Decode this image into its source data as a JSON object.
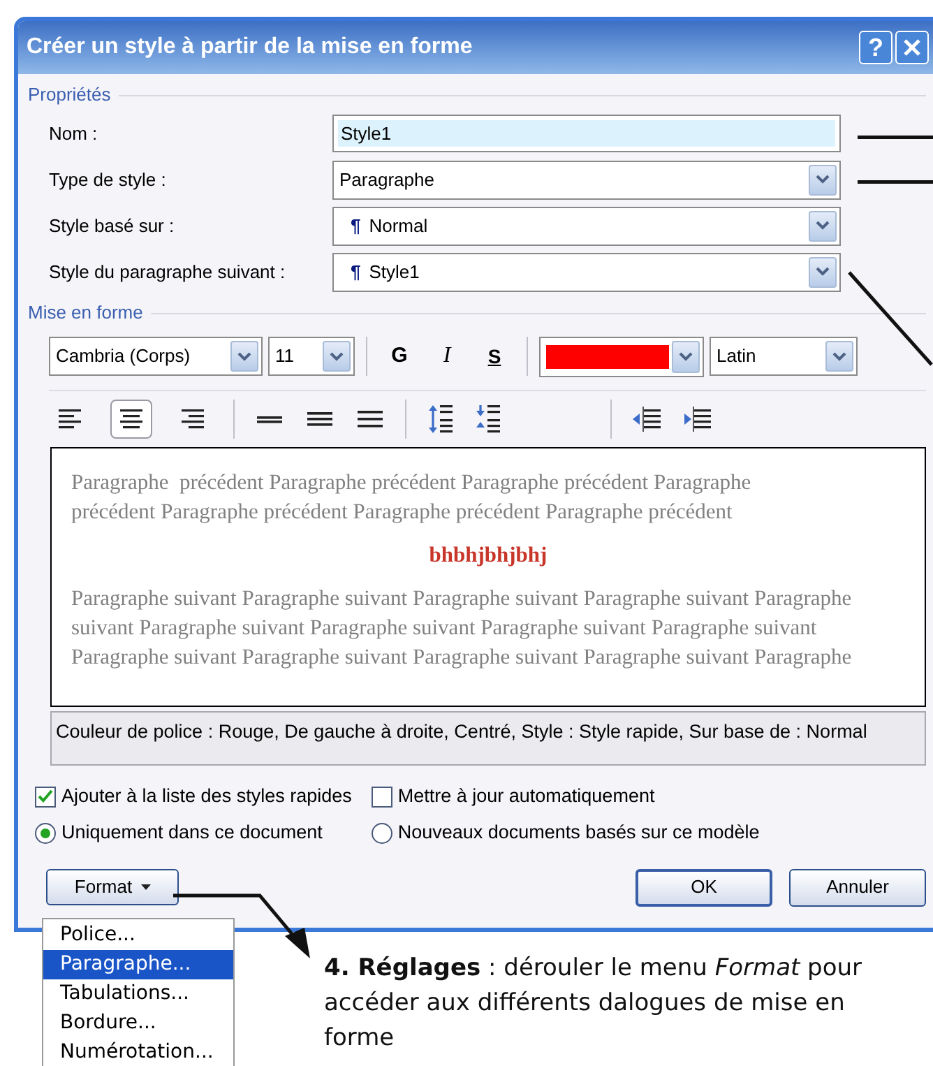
{
  "window": {
    "title": "Créer un style à partir de la mise en forme",
    "help": "?"
  },
  "properties": {
    "heading": "Propriétés",
    "fields": [
      {
        "kind": "text",
        "label": "Nom :",
        "value": "Style1"
      },
      {
        "kind": "dropdown",
        "label": "Type de style :",
        "value": "Paragraphe"
      },
      {
        "kind": "dropdown",
        "label": "Style basé sur :",
        "symbol": "¶",
        "value": "Normal"
      },
      {
        "kind": "dropdown",
        "label": "Style du paragraphe suivant :",
        "symbol": "¶",
        "value": "Style1"
      }
    ]
  },
  "formatting": {
    "heading": "Mise en forme",
    "font": "Cambria (Corps)",
    "size": "11",
    "bold": "G",
    "italic": "I",
    "underline": "S",
    "color_swatch": {
      "color": "#ff0000"
    },
    "script": "Latin",
    "alignment": [
      {
        "kind": "left",
        "selected": false
      },
      {
        "kind": "center",
        "selected": true
      },
      {
        "kind": "right",
        "selected": false
      }
    ]
  },
  "preview": {
    "before": [
      "Paragraphe  précédent Paragraphe précédent Paragraphe précédent Paragraphe",
      "précédent Paragraphe précédent Paragraphe précédent Paragraphe précédent"
    ],
    "sample": "bhbhjbhjbhj",
    "after": [
      "Paragraphe suivant Paragraphe suivant Paragraphe suivant Paragraphe suivant Paragraphe",
      "suivant Paragraphe suivant Paragraphe suivant Paragraphe suivant Paragraphe suivant",
      "Paragraphe suivant Paragraphe suivant Paragraphe suivant Paragraphe suivant Paragraphe"
    ]
  },
  "description": "Couleur de police : Rouge, De gauche à droite, Centré, Style : Style rapide, Sur base de : Normal",
  "options": [
    {
      "kind": "checkbox",
      "label": "Ajouter à la liste des styles rapides",
      "checked": true
    },
    {
      "kind": "checkbox",
      "label": "Mettre à jour automatiquement",
      "checked": false
    },
    {
      "kind": "radio",
      "label": "Uniquement dans ce document",
      "selected": true
    },
    {
      "kind": "radio",
      "label": "Nouveaux documents basés sur ce modèle",
      "selected": false
    }
  ],
  "buttons": {
    "format": "Format",
    "ok": "OK",
    "cancel": "Annuler"
  },
  "menu": [
    {
      "label": "Police...",
      "selected": false
    },
    {
      "label": "Paragraphe...",
      "selected": true
    },
    {
      "label": "Tabulations...",
      "selected": false
    },
    {
      "label": "Bordure...",
      "selected": false
    },
    {
      "label": "Numérotation...",
      "selected": false
    }
  ],
  "annotation": "**4. Réglages** : dérouler le menu *Format* pour accéder aux différents dalogues de mise en forme"
}
